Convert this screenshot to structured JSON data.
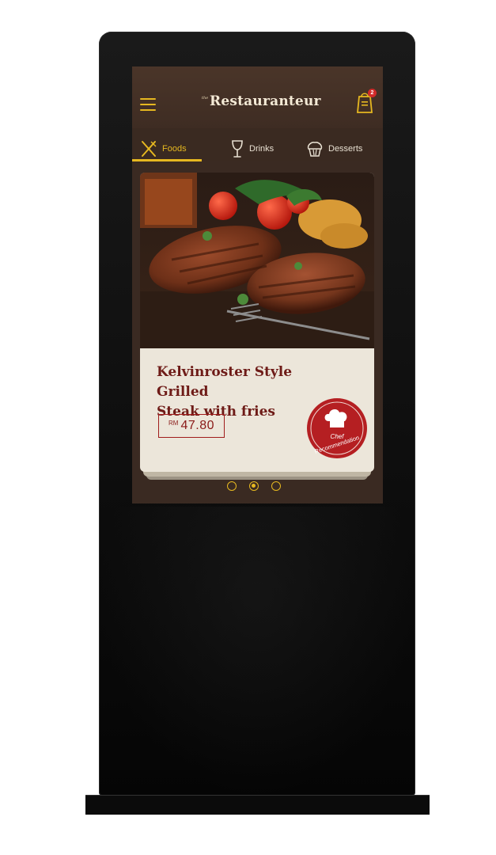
{
  "app": {
    "logo_prefix": "the",
    "logo_text": "Restauranteur",
    "cart_count": "2"
  },
  "tabs": [
    {
      "label": "Foods",
      "icon": "fork-knife-icon",
      "active": true
    },
    {
      "label": "Drinks",
      "icon": "wine-glass-icon",
      "active": false
    },
    {
      "label": "Desserts",
      "icon": "cupcake-icon",
      "active": false
    }
  ],
  "card": {
    "title_line1": "Kelvinroster Style Grilled",
    "title_line2": "Steak with fries",
    "currency": "RM",
    "price": "47.80",
    "badge_line1": "Chef",
    "badge_line2": "Recommendation"
  },
  "pager": {
    "total": 3,
    "active_index": 1
  },
  "colors": {
    "accent": "#e6b820",
    "title": "#6e1b17",
    "badge": "#b51f22",
    "card_bg": "#ece6da",
    "header_bg": "#3b2a21"
  }
}
